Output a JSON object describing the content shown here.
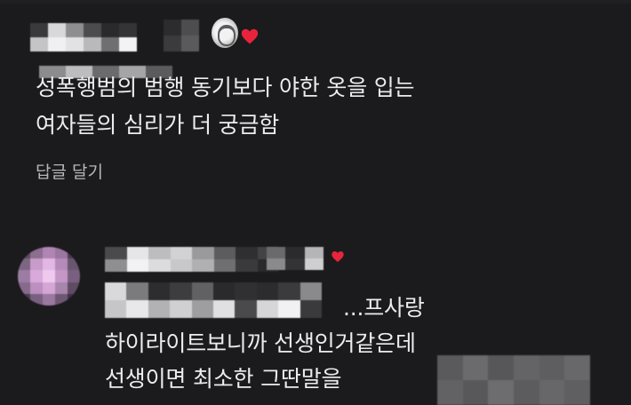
{
  "colors": {
    "background": "#1b1b1d",
    "text": "#ececee",
    "muted_text": "#b7b7bb",
    "heart": "#e8243c"
  },
  "icons": {
    "heart": "heart-icon",
    "reaction_avatar": "author-reaction-avatar"
  },
  "comment_1": {
    "author_redacted": true,
    "body_lines": [
      "성폭행범의 범행 동기보다 야한 옷을 입는",
      "여자들의 심리가 더 궁금함"
    ],
    "reply_label": "답글 달기"
  },
  "comment_2": {
    "author_redacted": true,
    "avatar_redacted": true,
    "body_lines": [
      "...프사랑",
      "하이라이트보니까 선생인거같은데",
      "선생이면 최소한 그딴말을"
    ],
    "trailing_text_redacted": true
  }
}
